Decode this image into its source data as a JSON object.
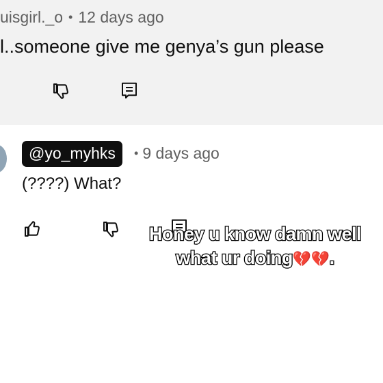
{
  "first_comment": {
    "username": "uisgirl._o",
    "separator": "•",
    "time": "12 days ago",
    "text": "l..someone give me genya’s gun please"
  },
  "reply": {
    "handle": "@yo_myhks",
    "separator": "•",
    "time": "9 days ago",
    "text": "(????) What?"
  },
  "overlay_caption": {
    "line1": "Honey u know damn well",
    "line2_text": "what ur doing",
    "line2_hearts": "💔💔",
    "line2_end": "."
  },
  "icons": [
    "dislike-icon",
    "reply-icon",
    "like-icon"
  ],
  "colors": {
    "top_background": "#f2f2f2",
    "meta_text": "#606060",
    "handle_badge": "#0f0f0f",
    "heart": "#d1202f"
  }
}
